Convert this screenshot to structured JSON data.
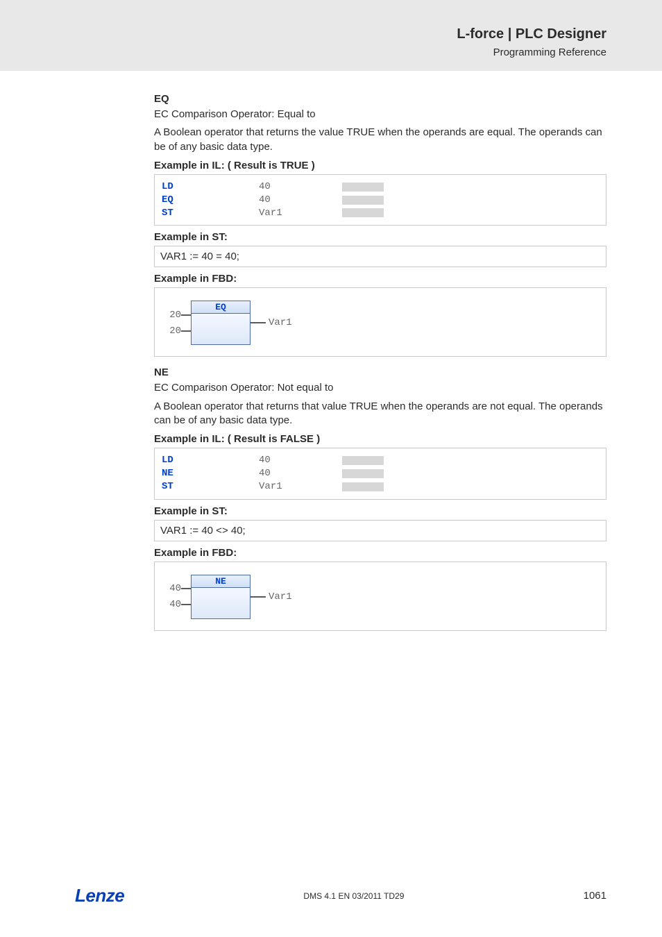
{
  "header": {
    "title": "L-force | PLC Designer",
    "subtitle": "Programming Reference"
  },
  "eq": {
    "heading": "EQ",
    "desc1": "EC Comparison Operator: Equal to",
    "desc2": "A Boolean operator that returns the value TRUE when the operands are equal. The operands can be of any basic data type.",
    "il_head": "Example in IL: ( Result is TRUE )",
    "il_rows": [
      {
        "op": "LD",
        "arg": "40"
      },
      {
        "op": "EQ",
        "arg": "40"
      },
      {
        "op": "ST",
        "arg": "Var1"
      }
    ],
    "st_head": "Example in ST:",
    "st_code": "VAR1 := 40 = 40;",
    "fbd_head": "Example in FBD:",
    "fbd": {
      "block": "EQ",
      "in1": "20",
      "in2": "20",
      "out": "Var1"
    }
  },
  "ne": {
    "heading": "NE",
    "desc1": "EC Comparison Operator: Not equal to",
    "desc2": "A Boolean operator that returns that value TRUE when the operands are not equal. The operands can be of any basic data type.",
    "il_head": "Example in IL: ( Result is FALSE )",
    "il_rows": [
      {
        "op": "LD",
        "arg": "40"
      },
      {
        "op": "NE",
        "arg": "40"
      },
      {
        "op": "ST",
        "arg": "Var1"
      }
    ],
    "st_head": "Example in ST:",
    "st_code": "VAR1 := 40 <> 40;",
    "fbd_head": "Example in FBD:",
    "fbd": {
      "block": "NE",
      "in1": "40",
      "in2": "40",
      "out": "Var1"
    }
  },
  "footer": {
    "logo": "Lenze",
    "mid": "DMS 4.1 EN 03/2011 TD29",
    "page": "1061"
  }
}
